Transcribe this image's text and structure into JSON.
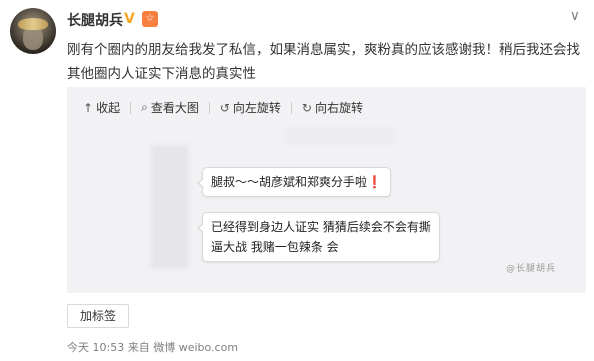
{
  "user": {
    "name": "长腿胡兵",
    "vip_icon": "V",
    "level_icon": "☆"
  },
  "post": {
    "text": "刚有个圈内的朋友给我发了私信，如果消息属实，爽粉真的应该感谢我！稍后我还会找其他圈内人证实下消息的真实性"
  },
  "image_toolbar": {
    "collapse": "收起",
    "view_large": "查看大图",
    "rotate_left": "向左旋转",
    "rotate_right": "向右旋转"
  },
  "chat": {
    "message1": "腿叔～～胡彦斌和郑爽分手啦❗",
    "message2": "已经得到身边人证实 猜猜后续会不会有撕逼大战 我赌一包辣条 会",
    "watermark": "@长腿胡兵"
  },
  "actions": {
    "add_tag": "加标签"
  },
  "meta": {
    "time": "今天 10:53",
    "source_prefix": "来自",
    "source": "微博 weibo.com"
  }
}
